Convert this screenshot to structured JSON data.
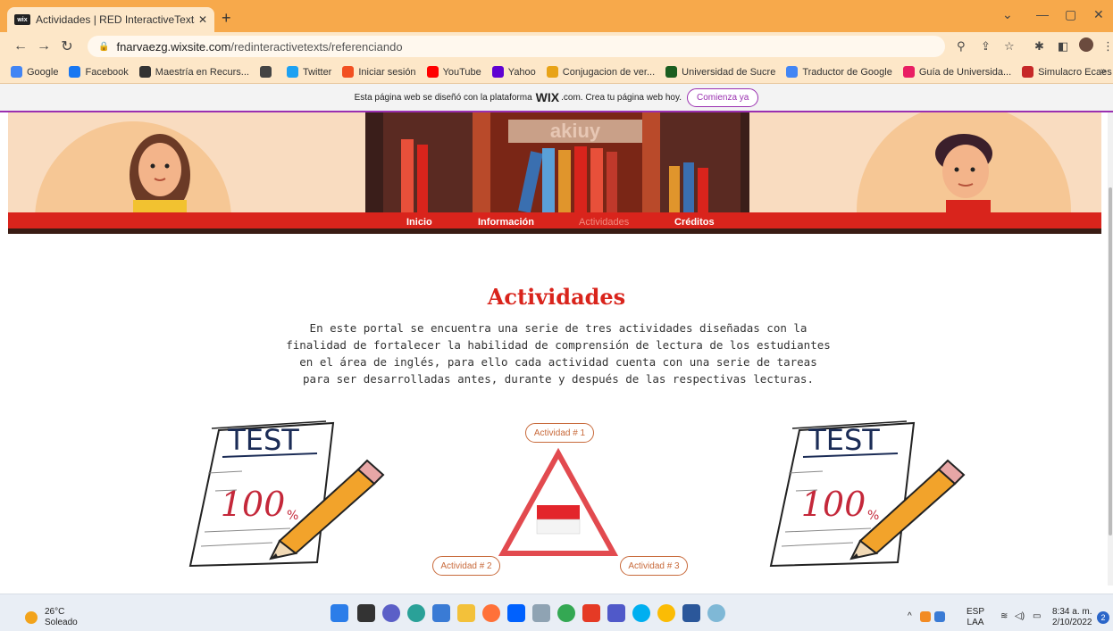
{
  "browser": {
    "tab_title": "Actividades | RED InteractiveTexts",
    "tab_favicon": "wix",
    "new_tab": "+",
    "url_host": "fnarvaezg.wixsite.com",
    "url_path": "/redinteractivetexts/referenciando"
  },
  "bookmarks": [
    {
      "label": "Google",
      "color": "#4285f4"
    },
    {
      "label": "Facebook",
      "color": "#1877f2"
    },
    {
      "label": "Maestría en Recurs...",
      "color": "#333333"
    },
    {
      "label": "",
      "color": "#444444"
    },
    {
      "label": "Twitter",
      "color": "#1da1f2"
    },
    {
      "label": "Iniciar sesión",
      "color": "#f25022"
    },
    {
      "label": "YouTube",
      "color": "#ff0000"
    },
    {
      "label": "Yahoo",
      "color": "#6001d2"
    },
    {
      "label": "Conjugacion de ver...",
      "color": "#e8a317"
    },
    {
      "label": "Universidad de Sucre",
      "color": "#1b5e20"
    },
    {
      "label": "Traductor de Google",
      "color": "#4285f4"
    },
    {
      "label": "Guía de Universida...",
      "color": "#e91e63"
    },
    {
      "label": "Simulacro Ecaes -...",
      "color": "#c62828"
    }
  ],
  "wix_banner": {
    "text_before": "Esta página web se diseñó con la plataforma",
    "wix": "WIX",
    "text_after": ".com. Crea tu página web hoy.",
    "cta": "Comienza ya"
  },
  "hero": {
    "sign": "akiuy"
  },
  "menu": [
    "Inicio",
    "Información",
    "Actividades",
    "Créditos"
  ],
  "content": {
    "heading": "Actividades",
    "intro": "En este portal se encuentra una serie de tres actividades diseñadas con la finalidad de fortalecer la habilidad de comprensión de lectura de los estudiantes en el área de inglés, para ello cada actividad cuenta con una serie de tareas para ser desarrolladas antes, durante y después de las respectivas lecturas.",
    "test_label": "TEST",
    "score_label": "100",
    "percent": "%",
    "activity1": "Actividad # 1",
    "activity2": "Actividad # 2",
    "activity3": "Actividad # 3"
  },
  "taskbar": {
    "temperature": "26°C",
    "weather": "Soleado",
    "lang": "ESP",
    "layout": "LAA",
    "time": "8:34 a. m.",
    "date": "2/10/2022",
    "notifications": "2"
  },
  "colors": {
    "accent": "#d9241c",
    "wix_purple": "#9a2fb0",
    "pill": "#c86a3b"
  }
}
